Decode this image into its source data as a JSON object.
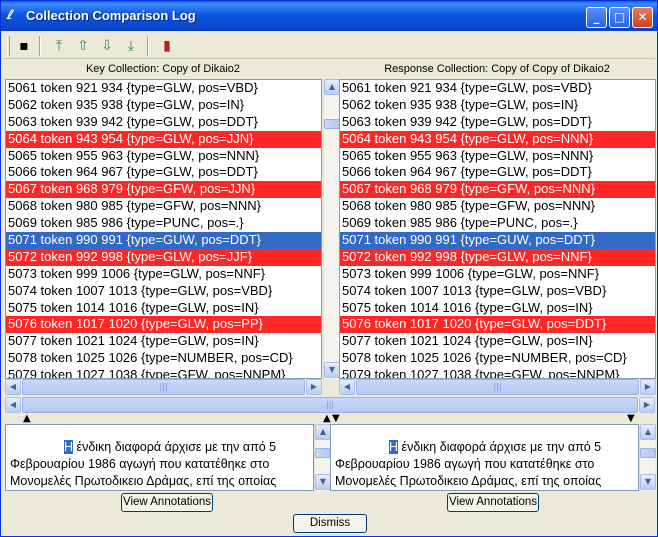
{
  "window": {
    "title": "Collection Comparison Log"
  },
  "toolbar": {
    "tools": [
      {
        "name": "save-icon",
        "glyph": "💾"
      },
      {
        "name": "move-top-icon",
        "glyph": "⇑"
      },
      {
        "name": "move-up-icon",
        "glyph": "⇧"
      },
      {
        "name": "move-down-icon",
        "glyph": "⇩"
      },
      {
        "name": "move-bottom-icon",
        "glyph": "⇓"
      },
      {
        "name": "exit-icon",
        "glyph": "▮"
      }
    ]
  },
  "key_collection": {
    "title": "Key Collection: Copy of Dikaio2",
    "rows": [
      {
        "text": "5061 token 921 934 {type=GLW, pos=VBD}",
        "state": "normal"
      },
      {
        "text": "5062 token 935 938 {type=GLW, pos=IN}",
        "state": "normal"
      },
      {
        "text": "5063 token 939 942 {type=GLW, pos=DDT}",
        "state": "normal"
      },
      {
        "text": "5064 token 943 954 {type=GLW, pos=JJN}",
        "state": "mismatch"
      },
      {
        "text": "5065 token 955 963 {type=GLW, pos=NNN}",
        "state": "normal"
      },
      {
        "text": "5066 token 964 967 {type=GLW, pos=DDT}",
        "state": "normal"
      },
      {
        "text": "5067 token 968 979 {type=GFW, pos=JJN}",
        "state": "mismatch"
      },
      {
        "text": "5068 token 980 985 {type=GFW, pos=NNN}",
        "state": "normal"
      },
      {
        "text": "5069 token 985 986 {type=PUNC, pos=.}",
        "state": "normal"
      },
      {
        "text": "5071 token 990 991 {type=GUW, pos=DDT}",
        "state": "selected"
      },
      {
        "text": "5072 token 992 998 {type=GLW, pos=JJF}",
        "state": "mismatch"
      },
      {
        "text": "5073 token 999 1006 {type=GLW, pos=NNF}",
        "state": "normal"
      },
      {
        "text": "5074 token 1007 1013 {type=GLW, pos=VBD}",
        "state": "normal"
      },
      {
        "text": "5075 token 1014 1016 {type=GLW, pos=IN}",
        "state": "normal"
      },
      {
        "text": "5076 token 1017 1020 {type=GLW, pos=PP}",
        "state": "mismatch"
      },
      {
        "text": "5077 token 1021 1024 {type=GLW, pos=IN}",
        "state": "normal"
      },
      {
        "text": "5078 token 1025 1026 {type=NUMBER, pos=CD}",
        "state": "normal"
      },
      {
        "text": "5079 token 1027 1038 {type=GFW, pos=NNPM}",
        "state": "normal"
      }
    ],
    "text_before_cursor": "",
    "cursor_char": "Η",
    "text_after_cursor": " ένδικη διαφορά άρχισε με την από 5 Φεβρουαρίου 1986 αγωγή που κατατέθηκε στο Μονομελές Πρωτοδικειο Δράμας, επί της οποίας",
    "view_button": "View Annotations"
  },
  "response_collection": {
    "title": "Response Collection: Copy of Copy of Dikaio2",
    "rows": [
      {
        "text": "5061 token 921 934 {type=GLW, pos=VBD}",
        "state": "normal"
      },
      {
        "text": "5062 token 935 938 {type=GLW, pos=IN}",
        "state": "normal"
      },
      {
        "text": "5063 token 939 942 {type=GLW, pos=DDT}",
        "state": "normal"
      },
      {
        "text": "5064 token 943 954 {type=GLW, pos=NNN}",
        "state": "mismatch"
      },
      {
        "text": "5065 token 955 963 {type=GLW, pos=NNN}",
        "state": "normal"
      },
      {
        "text": "5066 token 964 967 {type=GLW, pos=DDT}",
        "state": "normal"
      },
      {
        "text": "5067 token 968 979 {type=GFW, pos=NNN}",
        "state": "mismatch"
      },
      {
        "text": "5068 token 980 985 {type=GFW, pos=NNN}",
        "state": "normal"
      },
      {
        "text": "5069 token 985 986 {type=PUNC, pos=.}",
        "state": "normal"
      },
      {
        "text": "5071 token 990 991 {type=GUW, pos=DDT}",
        "state": "selected"
      },
      {
        "text": "5072 token 992 998 {type=GLW, pos=NNF}",
        "state": "mismatch"
      },
      {
        "text": "5073 token 999 1006 {type=GLW, pos=NNF}",
        "state": "normal"
      },
      {
        "text": "5074 token 1007 1013 {type=GLW, pos=VBD}",
        "state": "normal"
      },
      {
        "text": "5075 token 1014 1016 {type=GLW, pos=IN}",
        "state": "normal"
      },
      {
        "text": "5076 token 1017 1020 {type=GLW, pos=DDT}",
        "state": "mismatch"
      },
      {
        "text": "5077 token 1021 1024 {type=GLW, pos=IN}",
        "state": "normal"
      },
      {
        "text": "5078 token 1025 1026 {type=NUMBER, pos=CD}",
        "state": "normal"
      },
      {
        "text": "5079 token 1027 1038 {type=GFW, pos=NNPM}",
        "state": "normal"
      }
    ],
    "text_before_cursor": "",
    "cursor_char": "Η",
    "text_after_cursor": " ένδικη διαφορά άρχισε με την από 5 Φεβρουαρίου 1986 αγωγή που κατατέθηκε στο Μονομελές Πρωτοδικειο Δράμας, επί της οποίας",
    "view_button": "View Annotations"
  },
  "footer": {
    "dismiss_button": "Dismiss"
  },
  "colors": {
    "mismatch": "#ff2626",
    "selected": "#316ac5"
  }
}
